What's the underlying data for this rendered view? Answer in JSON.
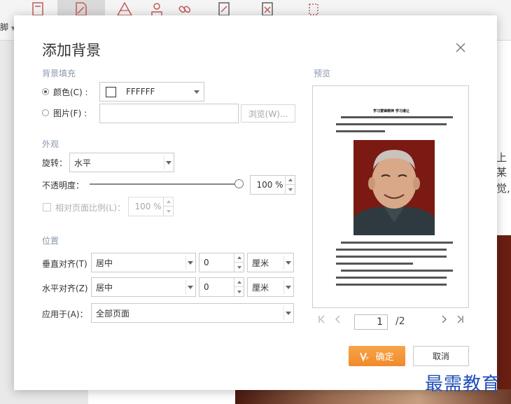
{
  "app": {
    "footer_menu": "脚",
    "bg_text_1": "上某",
    "bg_text_2": "觉,"
  },
  "dialog": {
    "title": "添加背景",
    "fill_section": "背景填充",
    "color_label": "颜色(C) :",
    "color_value": "FFFFFF",
    "picture_label": "图片(F) :",
    "browse_label": "浏览(W)...",
    "appearance_section": "外观",
    "rotate_label": "旋转：",
    "rotate_value": "水平",
    "opacity_label": "不透明度：",
    "opacity_value": "100 %",
    "opacity_level": 1.0,
    "relative_scale_label": "相对页面比例(L)：",
    "relative_scale_value": "100 %",
    "position_section": "位置",
    "vertical_label": "垂直对齐(T)",
    "vertical_value": "居中",
    "vertical_offset": "0",
    "vertical_unit": "厘米",
    "horizontal_label": "水平对齐(Z)",
    "horizontal_value": "居中",
    "horizontal_offset": "0",
    "horizontal_unit": "厘米",
    "apply_label": "应用于(A)：",
    "apply_value": "全部页面",
    "preview_section": "预览",
    "page_current": "1",
    "page_total": "/2",
    "ok_label": "确定",
    "cancel_label": "取消"
  },
  "preview_doc": {
    "heading": "学习雷锋精神 学习谦让"
  },
  "watermark": "最需教育",
  "colors": {
    "accent_orange": "#f39434",
    "section_label": "#8a97ad",
    "watermark_blue": "#1f4fb8"
  }
}
